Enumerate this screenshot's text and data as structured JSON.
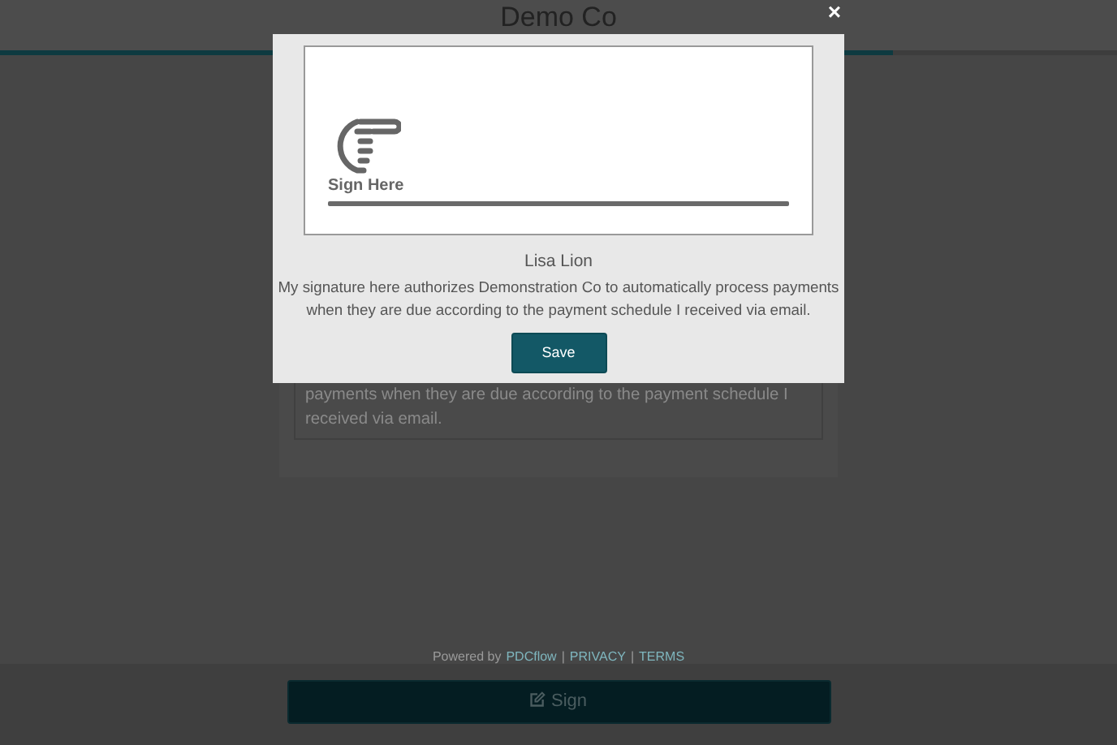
{
  "header": {
    "title": "Demo Co"
  },
  "progress": {
    "level": 0.8
  },
  "agreement_card": {
    "text": "payments when they are due according to the payment schedule I received via email."
  },
  "footer": [
    {
      "kind": "text",
      "text": "Powered by"
    },
    {
      "kind": "link",
      "text": "PDCflow"
    },
    {
      "kind": "text",
      "text": "|"
    },
    {
      "kind": "link",
      "text": "PRIVACY"
    },
    {
      "kind": "text",
      "text": "|"
    },
    {
      "kind": "link",
      "text": "TERMS"
    }
  ],
  "sign_button": {
    "label": "Sign"
  },
  "modal": {
    "close": "×",
    "signature_pad": {
      "label": "Sign Here"
    },
    "signer": "Lisa Lion",
    "statement": "My signature here authorizes Demonstration Co to automatically process payments when they are due according to the payment schedule I received via email.",
    "save_button": "Save"
  }
}
